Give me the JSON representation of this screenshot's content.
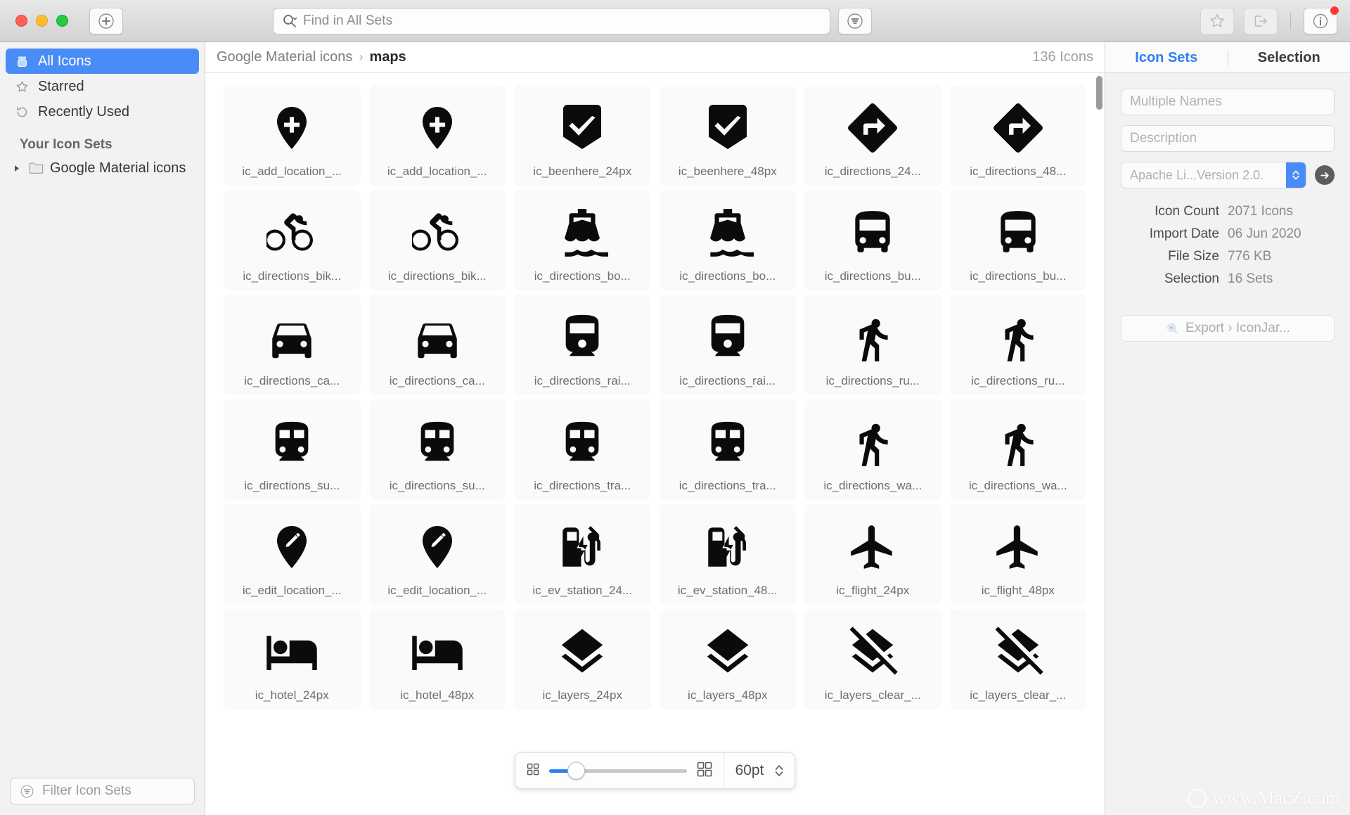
{
  "window": {
    "traffic_lights": [
      "close",
      "minimize",
      "maximize"
    ],
    "add_button_label": "+"
  },
  "toolbar": {
    "search_placeholder": "Find in All Sets",
    "search_icon": "search-icon",
    "filter_icon": "filter-icon",
    "star_icon": "star-icon",
    "export_icon": "export-icon",
    "info_icon": "info-icon",
    "accent": "#4a8cf7"
  },
  "sidebar": {
    "items": [
      {
        "label": "All Icons",
        "icon": "jar-icon",
        "selected": true
      },
      {
        "label": "Starred",
        "icon": "star-icon",
        "selected": false
      },
      {
        "label": "Recently Used",
        "icon": "history-icon",
        "selected": false
      }
    ],
    "group_title": "Your Icon Sets",
    "sets": [
      {
        "label": "Google Material icons",
        "icon": "folder-icon",
        "expanded": false
      }
    ],
    "filter_placeholder": "Filter Icon Sets"
  },
  "content": {
    "breadcrumb": {
      "root": "Google Material icons",
      "separator": "›",
      "current": "maps"
    },
    "icon_count": "136 Icons",
    "icons": [
      {
        "name": "ic_add_location_...",
        "glyph": "pin-add"
      },
      {
        "name": "ic_add_location_...",
        "glyph": "pin-add"
      },
      {
        "name": "ic_beenhere_24px",
        "glyph": "beenhere"
      },
      {
        "name": "ic_beenhere_48px",
        "glyph": "beenhere"
      },
      {
        "name": "ic_directions_24...",
        "glyph": "directions"
      },
      {
        "name": "ic_directions_48...",
        "glyph": "directions"
      },
      {
        "name": "ic_directions_bik...",
        "glyph": "bike"
      },
      {
        "name": "ic_directions_bik...",
        "glyph": "bike"
      },
      {
        "name": "ic_directions_bo...",
        "glyph": "boat"
      },
      {
        "name": "ic_directions_bo...",
        "glyph": "boat"
      },
      {
        "name": "ic_directions_bu...",
        "glyph": "bus"
      },
      {
        "name": "ic_directions_bu...",
        "glyph": "bus"
      },
      {
        "name": "ic_directions_ca...",
        "glyph": "car"
      },
      {
        "name": "ic_directions_ca...",
        "glyph": "car"
      },
      {
        "name": "ic_directions_rai...",
        "glyph": "railway"
      },
      {
        "name": "ic_directions_rai...",
        "glyph": "railway"
      },
      {
        "name": "ic_directions_ru...",
        "glyph": "run"
      },
      {
        "name": "ic_directions_ru...",
        "glyph": "run"
      },
      {
        "name": "ic_directions_su...",
        "glyph": "subway"
      },
      {
        "name": "ic_directions_su...",
        "glyph": "subway"
      },
      {
        "name": "ic_directions_tra...",
        "glyph": "subway"
      },
      {
        "name": "ic_directions_tra...",
        "glyph": "subway"
      },
      {
        "name": "ic_directions_wa...",
        "glyph": "walk"
      },
      {
        "name": "ic_directions_wa...",
        "glyph": "walk"
      },
      {
        "name": "ic_edit_location_...",
        "glyph": "pin-edit"
      },
      {
        "name": "ic_edit_location_...",
        "glyph": "pin-edit"
      },
      {
        "name": "ic_ev_station_24...",
        "glyph": "ev-station"
      },
      {
        "name": "ic_ev_station_48...",
        "glyph": "ev-station"
      },
      {
        "name": "ic_flight_24px",
        "glyph": "flight"
      },
      {
        "name": "ic_flight_48px",
        "glyph": "flight"
      },
      {
        "name": "ic_hotel_24px",
        "glyph": "hotel"
      },
      {
        "name": "ic_hotel_48px",
        "glyph": "hotel"
      },
      {
        "name": "ic_layers_24px",
        "glyph": "layers"
      },
      {
        "name": "ic_layers_48px",
        "glyph": "layers"
      },
      {
        "name": "ic_layers_clear_...",
        "glyph": "layers-clear"
      },
      {
        "name": "ic_layers_clear_...",
        "glyph": "layers-clear"
      }
    ]
  },
  "zoom_hud": {
    "small_icon": "grid-small-icon",
    "large_icon": "grid-large-icon",
    "size_value": "60pt",
    "slider_percent": 14,
    "stepper_icon": "stepper-icon"
  },
  "inspector": {
    "tabs": [
      {
        "label": "Icon Sets",
        "active": true
      },
      {
        "label": "Selection",
        "active": false
      }
    ],
    "name_placeholder": "Multiple Names",
    "description_placeholder": "Description",
    "license_value": "Apache Li...Version 2.0.",
    "license_go_icon": "arrow-right-icon",
    "meta": [
      {
        "key": "Icon Count",
        "value": "2071 Icons"
      },
      {
        "key": "Import Date",
        "value": "06 Jun 2020"
      },
      {
        "key": "File Size",
        "value": "776 KB"
      },
      {
        "key": "Selection",
        "value": "16 Sets"
      }
    ],
    "export_label": "Export › IconJar...",
    "export_icon": "export-small-icon"
  },
  "watermark": {
    "mark": "M",
    "text": "www.MacZ.com"
  }
}
